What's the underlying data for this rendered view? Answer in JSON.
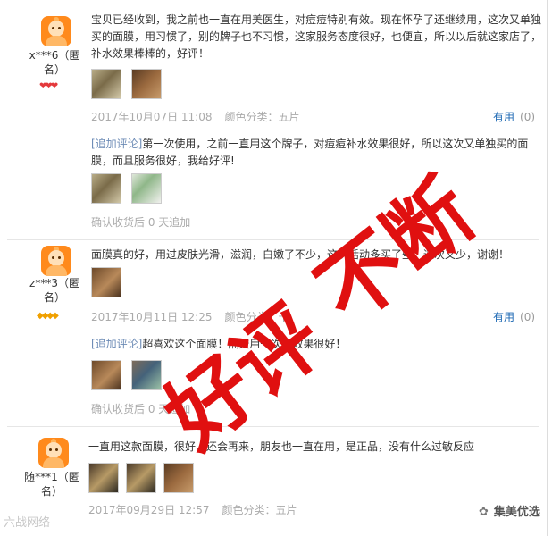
{
  "reviews": [
    {
      "user": "x***6（匿名）",
      "rank_icon": "red-hearts",
      "content": "宝贝已经收到，我之前也一直在用美医生，对痘痘特别有效。现在怀孕了还继续用，这次又单独买的面膜，用习惯了，别的牌子也不习惯，这家服务态度很好，也便宜，所以以后就这家店了，补水效果棒棒的，好评！",
      "date": "2017年10月07日 11:08",
      "spec": "颜色分类：五片",
      "useful_label": "有用",
      "useful_count": "(0)",
      "append_tag": "[追加评论]",
      "append_text": "第一次使用，之前一直用这个牌子，对痘痘补水效果很好，所以这次又单独买的面膜，而且服务很好，我给好评!",
      "append_meta": "确认收货后 0 天追加"
    },
    {
      "user": "z***3（匿名）",
      "rank_icon": "gold-diamonds",
      "content": "面膜真的好，用过皮肤光滑，滋润，白嫩了不少，这次活动多买了些，这次又少，谢谢！",
      "date": "2017年10月11日 12:25",
      "spec": "颜色分类：十",
      "useful_label": "有用",
      "useful_count": "(0)",
      "append_tag": "[追加评论]",
      "append_text": "超喜欢这个面膜！隔天用一次，效果很好！",
      "append_meta": "确认收货后 0 天追加"
    },
    {
      "user": "随***1（匿名）",
      "content": "一直用这款面膜，很好，还会再来，朋友也一直在用，是正品，没有什么过敏反应",
      "date": "2017年09月29日 12:57",
      "spec": "颜色分类：五片"
    }
  ],
  "stamp": {
    "line1": "好评",
    "line2": "不断",
    "color": "#e01010"
  },
  "watermarks": {
    "left": "六战网络",
    "right": "集美优选"
  }
}
